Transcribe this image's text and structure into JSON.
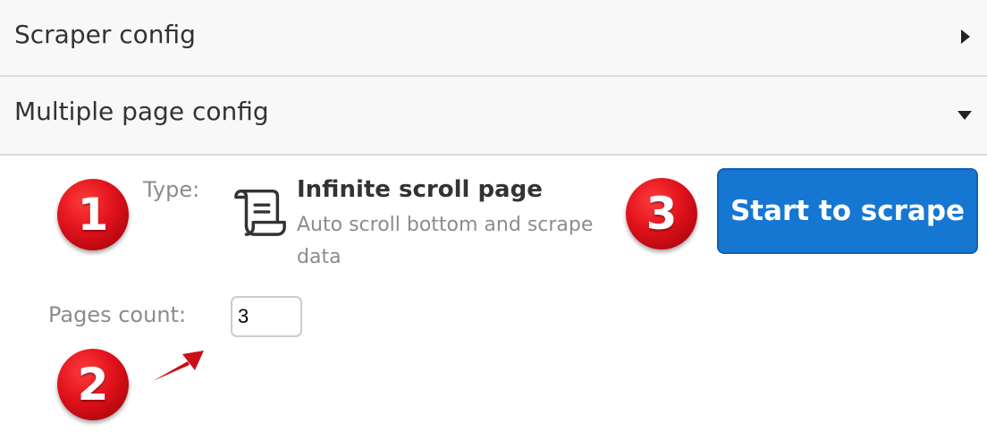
{
  "sections": {
    "scraper_config": {
      "title": "Scraper config",
      "icon": "caret-right-icon"
    },
    "multiple_page_config": {
      "title": "Multiple page config",
      "icon": "caret-down-icon"
    }
  },
  "form": {
    "type_label": "Type:",
    "type_icon": "scroll-icon",
    "type_title": "Infinite scroll page",
    "type_description": "Auto scroll bottom and scrape data",
    "pages_label": "Pages count:",
    "pages_value": "3"
  },
  "actions": {
    "start_label": "Start to scrape",
    "accent_color": "#1677d2"
  },
  "annotations": {
    "badge_1": "1",
    "badge_2": "2",
    "badge_3": "3",
    "badge_color": "#e0121b"
  }
}
